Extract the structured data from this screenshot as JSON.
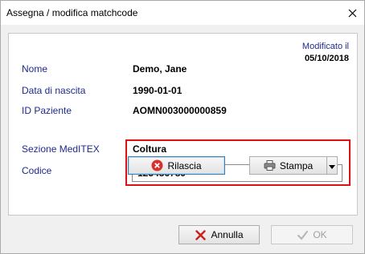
{
  "window": {
    "title": "Assegna / modifica matchcode"
  },
  "modified": {
    "label": "Modificato il",
    "date": "05/10/2018"
  },
  "patient": {
    "name_label": "Nome",
    "name_value": "Demo, Jane",
    "dob_label": "Data di nascita",
    "dob_value": "1990-01-01",
    "id_label": "ID Paziente",
    "id_value": "AOMN003000000859"
  },
  "section": {
    "label": "Sezione MedITEX",
    "value": "Coltura"
  },
  "code": {
    "label": "Codice",
    "value": "123456789"
  },
  "buttons": {
    "release": "Rilascia",
    "print": "Stampa",
    "cancel": "Annulla",
    "ok": "OK"
  },
  "colors": {
    "label_blue": "#1f2a8c",
    "highlight_red": "#e01010",
    "focus_blue": "#3c7fb1"
  },
  "icons": {
    "close": "close-icon",
    "release": "error-x-icon",
    "print": "printer-icon",
    "dropdown": "chevron-down-icon",
    "cancel": "x-icon",
    "ok": "check-icon"
  }
}
